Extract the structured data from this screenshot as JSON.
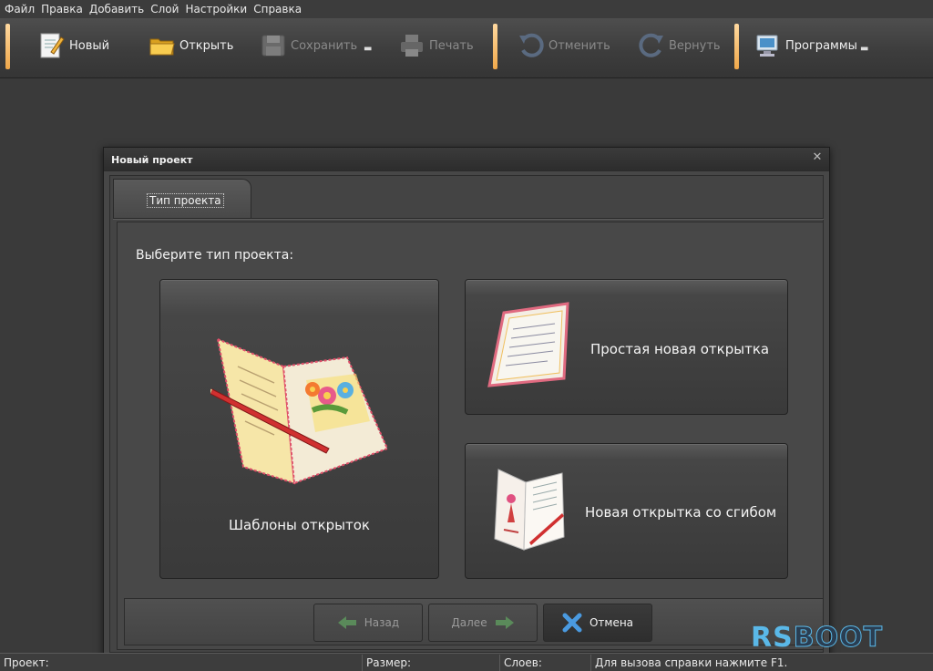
{
  "menubar": {
    "items": [
      "Файл",
      "Правка",
      "Добавить",
      "Слой",
      "Настройки",
      "Справка"
    ]
  },
  "toolbar": {
    "new": "Новый",
    "open": "Открыть",
    "save": "Сохранить",
    "print": "Печать",
    "undo": "Отменить",
    "redo": "Вернуть",
    "programs": "Программы"
  },
  "dialog": {
    "title": "Новый проект",
    "tab": "Тип проекта",
    "prompt": "Выберите тип проекта:",
    "cards": {
      "templates": "Шаблоны открыток",
      "simple": "Простая новая открытка",
      "folded": "Новая открытка со сгибом"
    },
    "buttons": {
      "back": "Назад",
      "next": "Далее",
      "cancel": "Отмена"
    }
  },
  "statusbar": {
    "project": "Проект:",
    "size": "Размер:",
    "layers": "Слоев:",
    "hint": "Для вызова справки нажмите F1."
  },
  "watermark": {
    "rs": "RS",
    "boot": "BOOT"
  }
}
